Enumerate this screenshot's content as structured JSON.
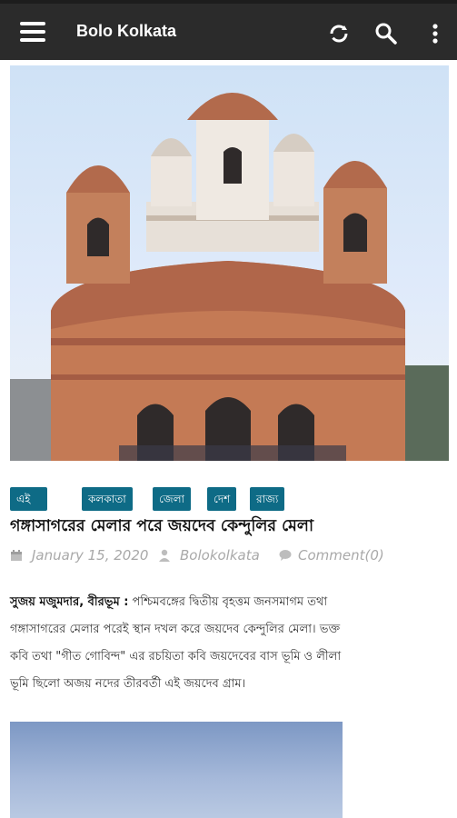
{
  "app": {
    "title": "Bolo Kolkata"
  },
  "toolbar": {
    "icons": [
      "menu-icon",
      "refresh-icon",
      "search-icon",
      "more-vertical-icon"
    ]
  },
  "article": {
    "tags": [
      "এই মুহূর্তে",
      "কলকাতা",
      "জেলা",
      "দেশ",
      "রাজ্য"
    ],
    "headline": "গঙ্গাসাগরের মেলার পরে জয়দেব কেন্দুলির মেলা",
    "meta": {
      "date": "January 15, 2020",
      "author": "Bolokolkata",
      "comments": "Comment(0)"
    },
    "byline": "সুজয় মজুমদার, বীরভূম :",
    "body_lines": [
      " পশ্চিমবঙ্গের দ্বিতীয় বৃহত্তম জনসমাগম তথা",
      "গঙ্গাসাগরের মেলার পরেই স্থান দখল করে জয়দেব কেন্দুলির মেলা। ভক্ত",
      "কবি তথা \"গীত গোবিন্দ\" এর রচয়িতা কবি জয়দেবের বাস ভূমি ও লীলা",
      "ভূমি ছিলো অজয় নদের তীরবর্তী এই জয়দেব গ্রাম।"
    ]
  },
  "colors": {
    "topbar": "#2b2b2b",
    "tag_bg": "#0e6b86",
    "meta_text": "#a9a9a9"
  }
}
